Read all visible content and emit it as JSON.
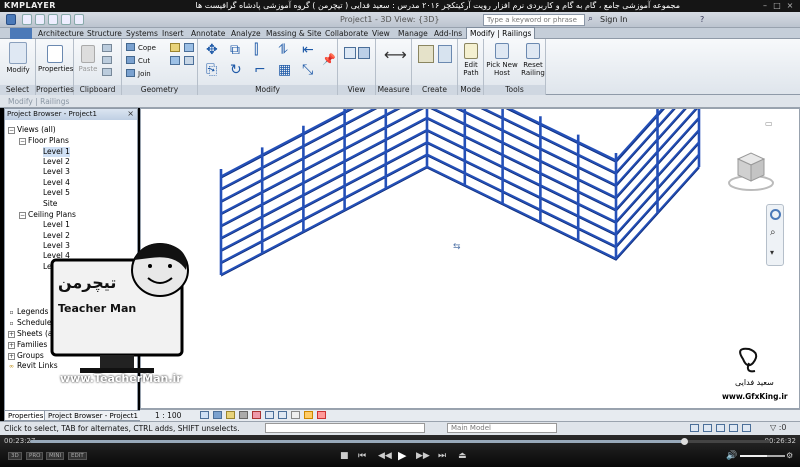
{
  "player": {
    "logo": "KMPLAYER",
    "video_title": "مجموعه آموزشی جامع ، گام به گام و کاربردی نرم افزار رویت آرکیتکچر ۲۰۱۶ مدرس : سعید فدایی ( تیچرمن ) گروه آموزشی پادشاه گرافیست ها",
    "current_time": "00:23:27",
    "total_time": "00:26:32",
    "progress": 0.884,
    "volume": 0.6,
    "tags": [
      "3D",
      "PRO",
      "MINI",
      "EDIT"
    ]
  },
  "revit": {
    "doc_title": "Project1 - 3D View: {3D}",
    "search_placeholder": "Type a keyword or phrase",
    "user": "Sign In",
    "tabs": [
      "Architecture",
      "Structure",
      "Systems",
      "Insert",
      "Annotate",
      "Analyze",
      "Massing & Site",
      "Collaborate",
      "View",
      "Manage",
      "Add-Ins",
      "Modify | Railings"
    ],
    "active_tab": "Modify | Railings",
    "panels": {
      "select": {
        "label": "Select",
        "modify": "Modify"
      },
      "properties": {
        "label": "Properties",
        "button": "Properties"
      },
      "clipboard": {
        "label": "Clipboard",
        "paste": "Paste"
      },
      "geometry": {
        "label": "Geometry",
        "cope": "Cope",
        "cut": "Cut",
        "join": "Join"
      },
      "modify": {
        "label": "Modify"
      },
      "view": {
        "label": "View"
      },
      "measure": {
        "label": "Measure"
      },
      "create": {
        "label": "Create"
      },
      "mode": {
        "label": "Mode",
        "edit_path": "Edit Path"
      },
      "tools": {
        "label": "Tools",
        "pick_new_host": "Pick New Host",
        "reset_railing": "Reset Railing"
      }
    },
    "context_label": "Modify | Railings",
    "status_text": "Click to select, TAB for alternates, CTRL adds, SHIFT unselects.",
    "workset": "Main Model",
    "scale": "1 : 100"
  },
  "project_browser": {
    "title": "Project Browser - Project1",
    "close": "×",
    "tree": {
      "views": "Views (all)",
      "floor_plans": "Floor Plans",
      "floor_levels": [
        "Level 1",
        "Level 2",
        "Level 3",
        "Level 4",
        "Level 5",
        "Site"
      ],
      "ceiling_plans": "Ceiling Plans",
      "ceiling_levels": [
        "Level 1",
        "Level 2",
        "Level 3",
        "Level 4",
        "Level 5"
      ],
      "legends": "Legends",
      "schedules": "Schedules/Quantities",
      "sheets": "Sheets (all)",
      "families": "Families",
      "groups": "Groups",
      "links": "Revit Links"
    },
    "tabs": [
      "Properties",
      "Project Browser - Project1"
    ]
  },
  "watermark": {
    "brand_fa": "تیچرمن",
    "brand_en": "Teacher Man",
    "site": "www.TeacherMan.ir",
    "gfx_name": "سعید فدایی",
    "gfx_site": "www.GfxKing.ir"
  },
  "colors": {
    "railing": "#2450b8",
    "railing_dark": "#13307a",
    "ribbon_active": "#f3f6fa"
  }
}
